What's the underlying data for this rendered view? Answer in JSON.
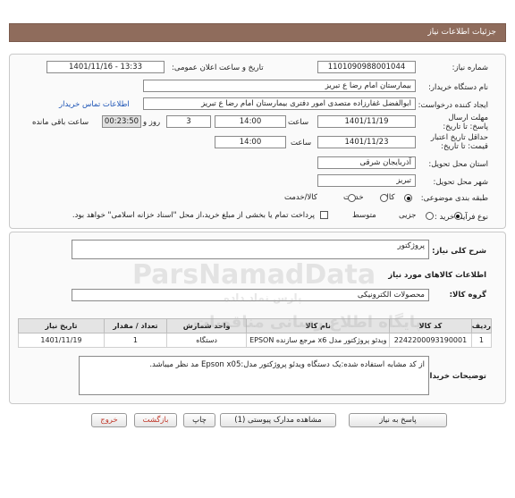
{
  "header": {
    "title": "جزئیات اطلاعات نیاز"
  },
  "form": {
    "need_number_label": "شماره نیاز:",
    "need_number": "1101090988001044",
    "announce_label": "تاریخ و ساعت اعلان عمومی:",
    "announce_value": "1401/11/16 - 13:33",
    "buyer_org_label": "نام دستگاه خریدار:",
    "buyer_org": "بیمارستان امام رضا  ع  تبریز",
    "creator_label": "ایجاد کننده درخواست:",
    "creator": "ابوالفضل غفارزاده متصدی امور دفتری بیمارستان امام رضا  ع  تبریز",
    "contact_link": "اطلاعات تماس خریدار",
    "deadline_label": "مهلت ارسال پاسخ: تا تاریخ:",
    "deadline_date": "1401/11/19",
    "time_label": "ساعت",
    "deadline_time": "14:00",
    "days_value": "3",
    "days_label": "روز و",
    "remaining_time": "00:23:50",
    "remaining_label": "ساعت باقی مانده",
    "validity_label": "حداقل تاریخ اعتبار قیمت: تا تاریخ:",
    "validity_date": "1401/11/23",
    "validity_time_label": "ساعت",
    "validity_time": "14:00",
    "province_label": "استان محل تحویل:",
    "province": "آذربایجان شرقی",
    "city_label": "شهر محل تحویل:",
    "city": "تبریز",
    "category_label": "طبقه بندی موضوعی:",
    "category_options": [
      "کالا",
      "خدمت",
      "کالا/خدمت"
    ],
    "process_label": "نوع فرآیند خرید :",
    "process_options": [
      "جزیی",
      "متوسط"
    ],
    "payment_note": "پرداخت تمام یا بخشی از مبلغ خرید،از محل \"اسناد خزانه اسلامی\" خواهد بود."
  },
  "general": {
    "summary_label": "شرح کلی نیاز:",
    "summary": "پروژکتور",
    "goods_info_title": "اطلاعات کالاهای مورد نیاز",
    "group_label": "گروه کالا:",
    "group": "محصولات الکترونیکی"
  },
  "table": {
    "headers": [
      "ردیف",
      "کد کالا",
      "نام کالا",
      "واحد شمارش",
      "تعداد / مقدار",
      "تاریخ نیاز"
    ],
    "rows": [
      [
        "1",
        "2242200093190001",
        "ویدئو پروژکتور مدل x6 مرجع سازنده EPSON",
        "دستگاه",
        "1",
        "1401/11/19"
      ]
    ]
  },
  "buyer_notes": {
    "label": "توضیحات خریدار:",
    "text": "از کد مشابه استفاده شده:یک دستگاه ویدئو پروژکتور مدل:Epson x05 مد نظر میباشد."
  },
  "buttons": {
    "reply": "پاسخ به نیاز",
    "attachments": "مشاهده مدارک پیوستی (1)",
    "print": "چاپ",
    "back": "بازگشت",
    "exit": "خروج"
  },
  "watermark": {
    "brand": "ParsNamadData",
    "brand_fa": "پارس نماد داده",
    "tagline": "پایگاه اطلاع رسانی مناقصات"
  }
}
